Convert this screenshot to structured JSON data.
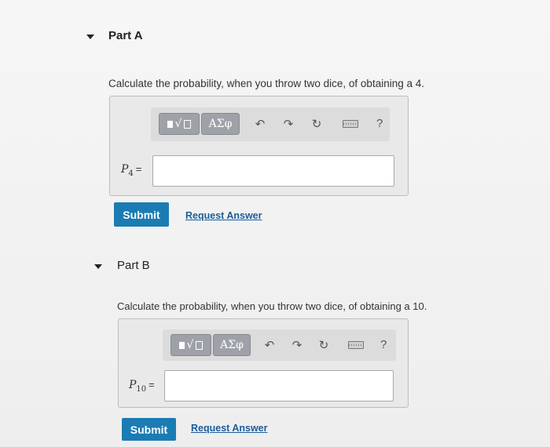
{
  "partA": {
    "title": "Part A",
    "question": "Calculate the probability, when you throw two dice, of obtaining a 4.",
    "var_base": "P",
    "var_sub": "4",
    "eq": "=",
    "greek": "ΑΣφ",
    "radical": "√",
    "help": "?",
    "answer_value": "",
    "submit_label": "Submit",
    "request_label": "Request Answer"
  },
  "partB": {
    "title": "Part B",
    "question": "Calculate the probability, when you throw two dice, of obtaining a 10.",
    "var_base": "P",
    "var_sub": "10",
    "eq": "=",
    "greek": "ΑΣφ",
    "radical": "√",
    "help": "?",
    "answer_value": "",
    "submit_label": "Submit",
    "request_label": "Request Answer"
  },
  "icons": {
    "undo": "undo-icon",
    "redo": "redo-icon",
    "reset": "reset-icon",
    "keyboard": "keyboard-icon",
    "templates": "templates-icon"
  },
  "colors": {
    "submit": "#1a7cb3",
    "link": "#1c5d9b",
    "toolbar_button": "#9ea2a8"
  }
}
